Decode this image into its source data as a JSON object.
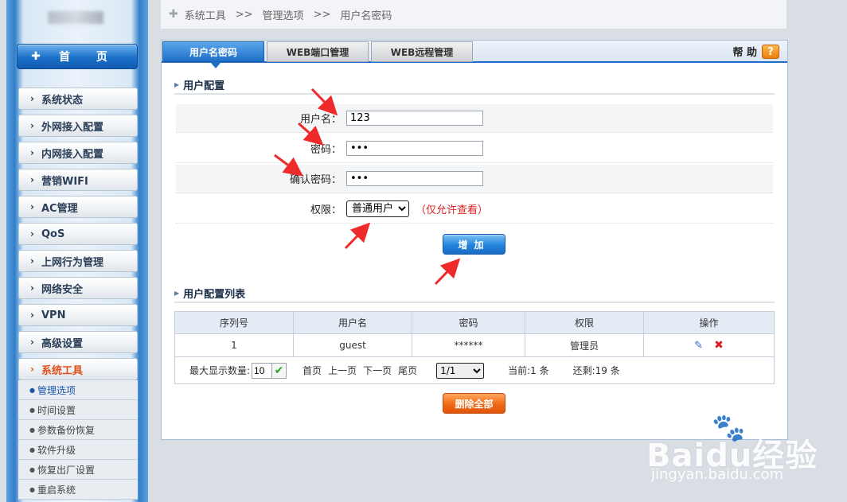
{
  "breadcrumb": {
    "items": [
      "系统工具",
      "管理选项",
      "用户名密码"
    ],
    "sep": ">>"
  },
  "sidebar": {
    "home": "首 页",
    "items": [
      {
        "label": "系统状态"
      },
      {
        "label": "外网接入配置"
      },
      {
        "label": "内网接入配置"
      },
      {
        "label": "营销WIFI"
      },
      {
        "label": "AC管理"
      },
      {
        "label": "QoS"
      },
      {
        "label": "上网行为管理"
      },
      {
        "label": "网络安全"
      },
      {
        "label": "VPN"
      },
      {
        "label": "高级设置"
      },
      {
        "label": "系统工具"
      }
    ],
    "sub_items": [
      "管理选项",
      "时间设置",
      "参数备份恢复",
      "软件升级",
      "恢复出厂设置",
      "重启系统"
    ]
  },
  "tabs": [
    "用户名密码",
    "WEB端口管理",
    "WEB远程管理"
  ],
  "help": {
    "label": "帮 助",
    "icon": "?"
  },
  "user_config": {
    "title": "用户配置",
    "username_label": "用户名：",
    "username_value": "123",
    "password_label": "密码：",
    "password_value": "•••",
    "confirm_label": "确认密码：",
    "confirm_value": "•••",
    "permission_label": "权限：",
    "permission_value": "普通用户",
    "permission_note": "（仅允许查看）",
    "add_button": "增加"
  },
  "user_list": {
    "title": "用户配置列表",
    "headers": [
      "序列号",
      "用户名",
      "密码",
      "权限",
      "操作"
    ],
    "rows": [
      {
        "index": "1",
        "username": "guest",
        "password": "******",
        "role": "管理员"
      }
    ],
    "pager": {
      "max_label": "最大显示数量:",
      "max_value": "10",
      "first": "首页",
      "prev": "上一页",
      "next": "下一页",
      "last": "尾页",
      "page_value": "1/1",
      "current": "当前:1 条",
      "remaining": "还剩:19 条"
    },
    "delete_all": "删除全部"
  },
  "watermark": {
    "brand": "Baidu经验",
    "sub": "jingyan.baidu.com"
  },
  "colors": {
    "accent": "#1e6ec8",
    "active_menu": "#e0521a",
    "warning": "#e02020"
  }
}
